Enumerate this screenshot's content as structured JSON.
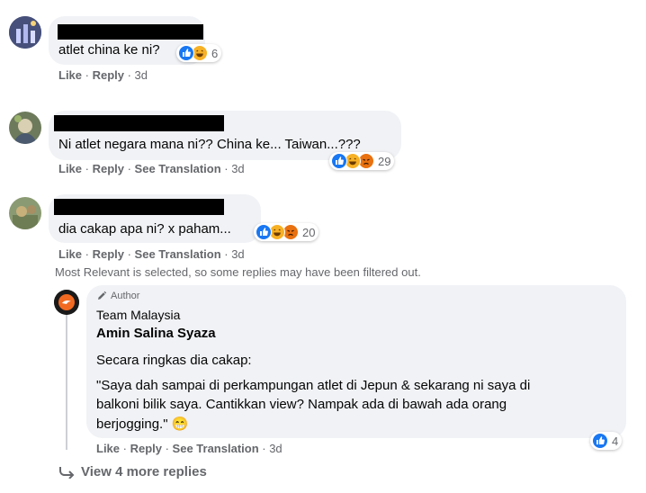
{
  "comments": [
    {
      "text": "atlet china ke ni?",
      "reaction_count": "6",
      "actions": {
        "like": "Like",
        "reply": "Reply",
        "time": "3d"
      }
    },
    {
      "text": "Ni atlet negara mana ni?? China ke... Taiwan...???",
      "reaction_count": "29",
      "actions": {
        "like": "Like",
        "reply": "Reply",
        "translate": "See Translation",
        "time": "3d"
      }
    },
    {
      "text": "dia cakap apa ni? x paham...",
      "reaction_count": "20",
      "actions": {
        "like": "Like",
        "reply": "Reply",
        "translate": "See Translation",
        "time": "3d"
      }
    }
  ],
  "filter_notice": "Most Relevant is selected, so some replies may have been filtered out.",
  "reply": {
    "author_badge": "Author",
    "page_name": "Team Malaysia",
    "sub_author": "Amin Salina Syaza",
    "intro": "Secara ringkas dia cakap:",
    "quote_lines": [
      "\"Saya dah sampai di perkampungan atlet di Jepun & sekarang ni saya di",
      "balkoni bilik saya. Cantikkan view? Nampak ada di bawah ada orang",
      "berjogging.\""
    ],
    "emoji": "😁",
    "reaction_count": "4",
    "actions": {
      "like": "Like",
      "reply": "Reply",
      "translate": "See Translation",
      "time": "3d"
    }
  },
  "view_more": "View 4 more replies",
  "colors": {
    "like_blue": "#1877f2",
    "haha_yellow": "#f7b125",
    "angry_orange": "#e9710f",
    "bubble": "#f0f2f5",
    "meta_grey": "#65676b"
  }
}
